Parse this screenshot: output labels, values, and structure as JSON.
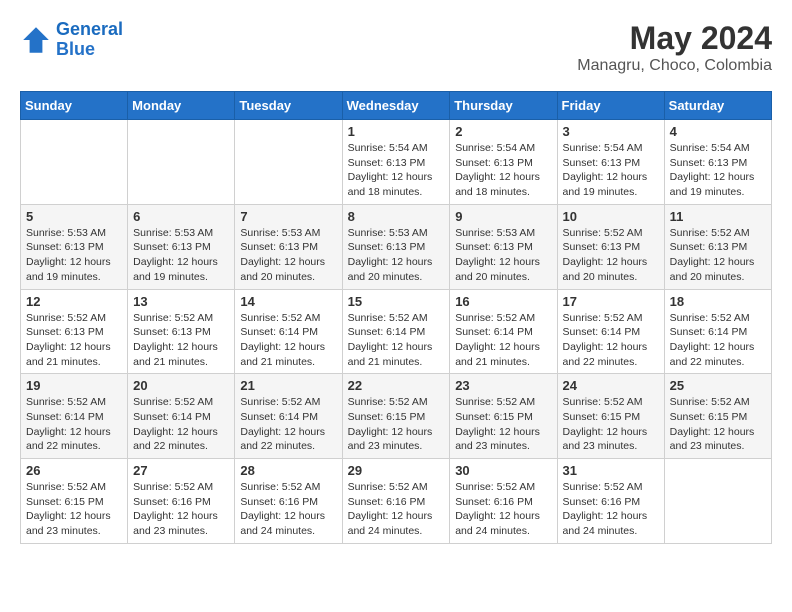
{
  "header": {
    "logo_line1": "General",
    "logo_line2": "Blue",
    "month_year": "May 2024",
    "location": "Managru, Choco, Colombia"
  },
  "weekdays": [
    "Sunday",
    "Monday",
    "Tuesday",
    "Wednesday",
    "Thursday",
    "Friday",
    "Saturday"
  ],
  "weeks": [
    [
      {
        "day": "",
        "info": ""
      },
      {
        "day": "",
        "info": ""
      },
      {
        "day": "",
        "info": ""
      },
      {
        "day": "1",
        "info": "Sunrise: 5:54 AM\nSunset: 6:13 PM\nDaylight: 12 hours\nand 18 minutes."
      },
      {
        "day": "2",
        "info": "Sunrise: 5:54 AM\nSunset: 6:13 PM\nDaylight: 12 hours\nand 18 minutes."
      },
      {
        "day": "3",
        "info": "Sunrise: 5:54 AM\nSunset: 6:13 PM\nDaylight: 12 hours\nand 19 minutes."
      },
      {
        "day": "4",
        "info": "Sunrise: 5:54 AM\nSunset: 6:13 PM\nDaylight: 12 hours\nand 19 minutes."
      }
    ],
    [
      {
        "day": "5",
        "info": "Sunrise: 5:53 AM\nSunset: 6:13 PM\nDaylight: 12 hours\nand 19 minutes."
      },
      {
        "day": "6",
        "info": "Sunrise: 5:53 AM\nSunset: 6:13 PM\nDaylight: 12 hours\nand 19 minutes."
      },
      {
        "day": "7",
        "info": "Sunrise: 5:53 AM\nSunset: 6:13 PM\nDaylight: 12 hours\nand 20 minutes."
      },
      {
        "day": "8",
        "info": "Sunrise: 5:53 AM\nSunset: 6:13 PM\nDaylight: 12 hours\nand 20 minutes."
      },
      {
        "day": "9",
        "info": "Sunrise: 5:53 AM\nSunset: 6:13 PM\nDaylight: 12 hours\nand 20 minutes."
      },
      {
        "day": "10",
        "info": "Sunrise: 5:52 AM\nSunset: 6:13 PM\nDaylight: 12 hours\nand 20 minutes."
      },
      {
        "day": "11",
        "info": "Sunrise: 5:52 AM\nSunset: 6:13 PM\nDaylight: 12 hours\nand 20 minutes."
      }
    ],
    [
      {
        "day": "12",
        "info": "Sunrise: 5:52 AM\nSunset: 6:13 PM\nDaylight: 12 hours\nand 21 minutes."
      },
      {
        "day": "13",
        "info": "Sunrise: 5:52 AM\nSunset: 6:13 PM\nDaylight: 12 hours\nand 21 minutes."
      },
      {
        "day": "14",
        "info": "Sunrise: 5:52 AM\nSunset: 6:14 PM\nDaylight: 12 hours\nand 21 minutes."
      },
      {
        "day": "15",
        "info": "Sunrise: 5:52 AM\nSunset: 6:14 PM\nDaylight: 12 hours\nand 21 minutes."
      },
      {
        "day": "16",
        "info": "Sunrise: 5:52 AM\nSunset: 6:14 PM\nDaylight: 12 hours\nand 21 minutes."
      },
      {
        "day": "17",
        "info": "Sunrise: 5:52 AM\nSunset: 6:14 PM\nDaylight: 12 hours\nand 22 minutes."
      },
      {
        "day": "18",
        "info": "Sunrise: 5:52 AM\nSunset: 6:14 PM\nDaylight: 12 hours\nand 22 minutes."
      }
    ],
    [
      {
        "day": "19",
        "info": "Sunrise: 5:52 AM\nSunset: 6:14 PM\nDaylight: 12 hours\nand 22 minutes."
      },
      {
        "day": "20",
        "info": "Sunrise: 5:52 AM\nSunset: 6:14 PM\nDaylight: 12 hours\nand 22 minutes."
      },
      {
        "day": "21",
        "info": "Sunrise: 5:52 AM\nSunset: 6:14 PM\nDaylight: 12 hours\nand 22 minutes."
      },
      {
        "day": "22",
        "info": "Sunrise: 5:52 AM\nSunset: 6:15 PM\nDaylight: 12 hours\nand 23 minutes."
      },
      {
        "day": "23",
        "info": "Sunrise: 5:52 AM\nSunset: 6:15 PM\nDaylight: 12 hours\nand 23 minutes."
      },
      {
        "day": "24",
        "info": "Sunrise: 5:52 AM\nSunset: 6:15 PM\nDaylight: 12 hours\nand 23 minutes."
      },
      {
        "day": "25",
        "info": "Sunrise: 5:52 AM\nSunset: 6:15 PM\nDaylight: 12 hours\nand 23 minutes."
      }
    ],
    [
      {
        "day": "26",
        "info": "Sunrise: 5:52 AM\nSunset: 6:15 PM\nDaylight: 12 hours\nand 23 minutes."
      },
      {
        "day": "27",
        "info": "Sunrise: 5:52 AM\nSunset: 6:16 PM\nDaylight: 12 hours\nand 23 minutes."
      },
      {
        "day": "28",
        "info": "Sunrise: 5:52 AM\nSunset: 6:16 PM\nDaylight: 12 hours\nand 24 minutes."
      },
      {
        "day": "29",
        "info": "Sunrise: 5:52 AM\nSunset: 6:16 PM\nDaylight: 12 hours\nand 24 minutes."
      },
      {
        "day": "30",
        "info": "Sunrise: 5:52 AM\nSunset: 6:16 PM\nDaylight: 12 hours\nand 24 minutes."
      },
      {
        "day": "31",
        "info": "Sunrise: 5:52 AM\nSunset: 6:16 PM\nDaylight: 12 hours\nand 24 minutes."
      },
      {
        "day": "",
        "info": ""
      }
    ]
  ]
}
